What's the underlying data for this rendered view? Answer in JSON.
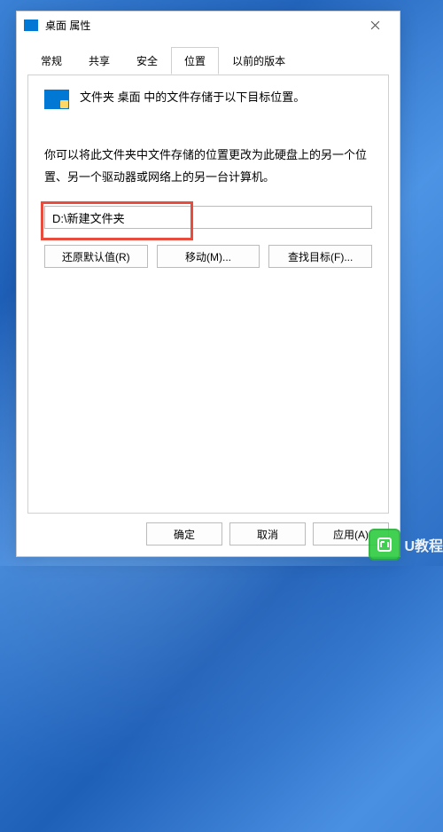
{
  "dialog": {
    "title": "桌面 属性",
    "close_label": "×"
  },
  "tabs": {
    "general": "常规",
    "sharing": "共享",
    "security": "安全",
    "location": "位置",
    "previous": "以前的版本"
  },
  "location_panel": {
    "storage_desc": "文件夹 桌面 中的文件存储于以下目标位置。",
    "change_info": "你可以将此文件夹中文件存储的位置更改为此硬盘上的另一个位置、另一个驱动器或网络上的另一台计算机。",
    "path_value": "D:\\新建文件夹",
    "restore_label": "还原默认值(R)",
    "move_label": "移动(M)...",
    "find_label": "查找目标(F)..."
  },
  "footer": {
    "ok": "确定",
    "cancel": "取消",
    "apply": "应用(A)"
  },
  "watermark": {
    "text": "U教程"
  }
}
